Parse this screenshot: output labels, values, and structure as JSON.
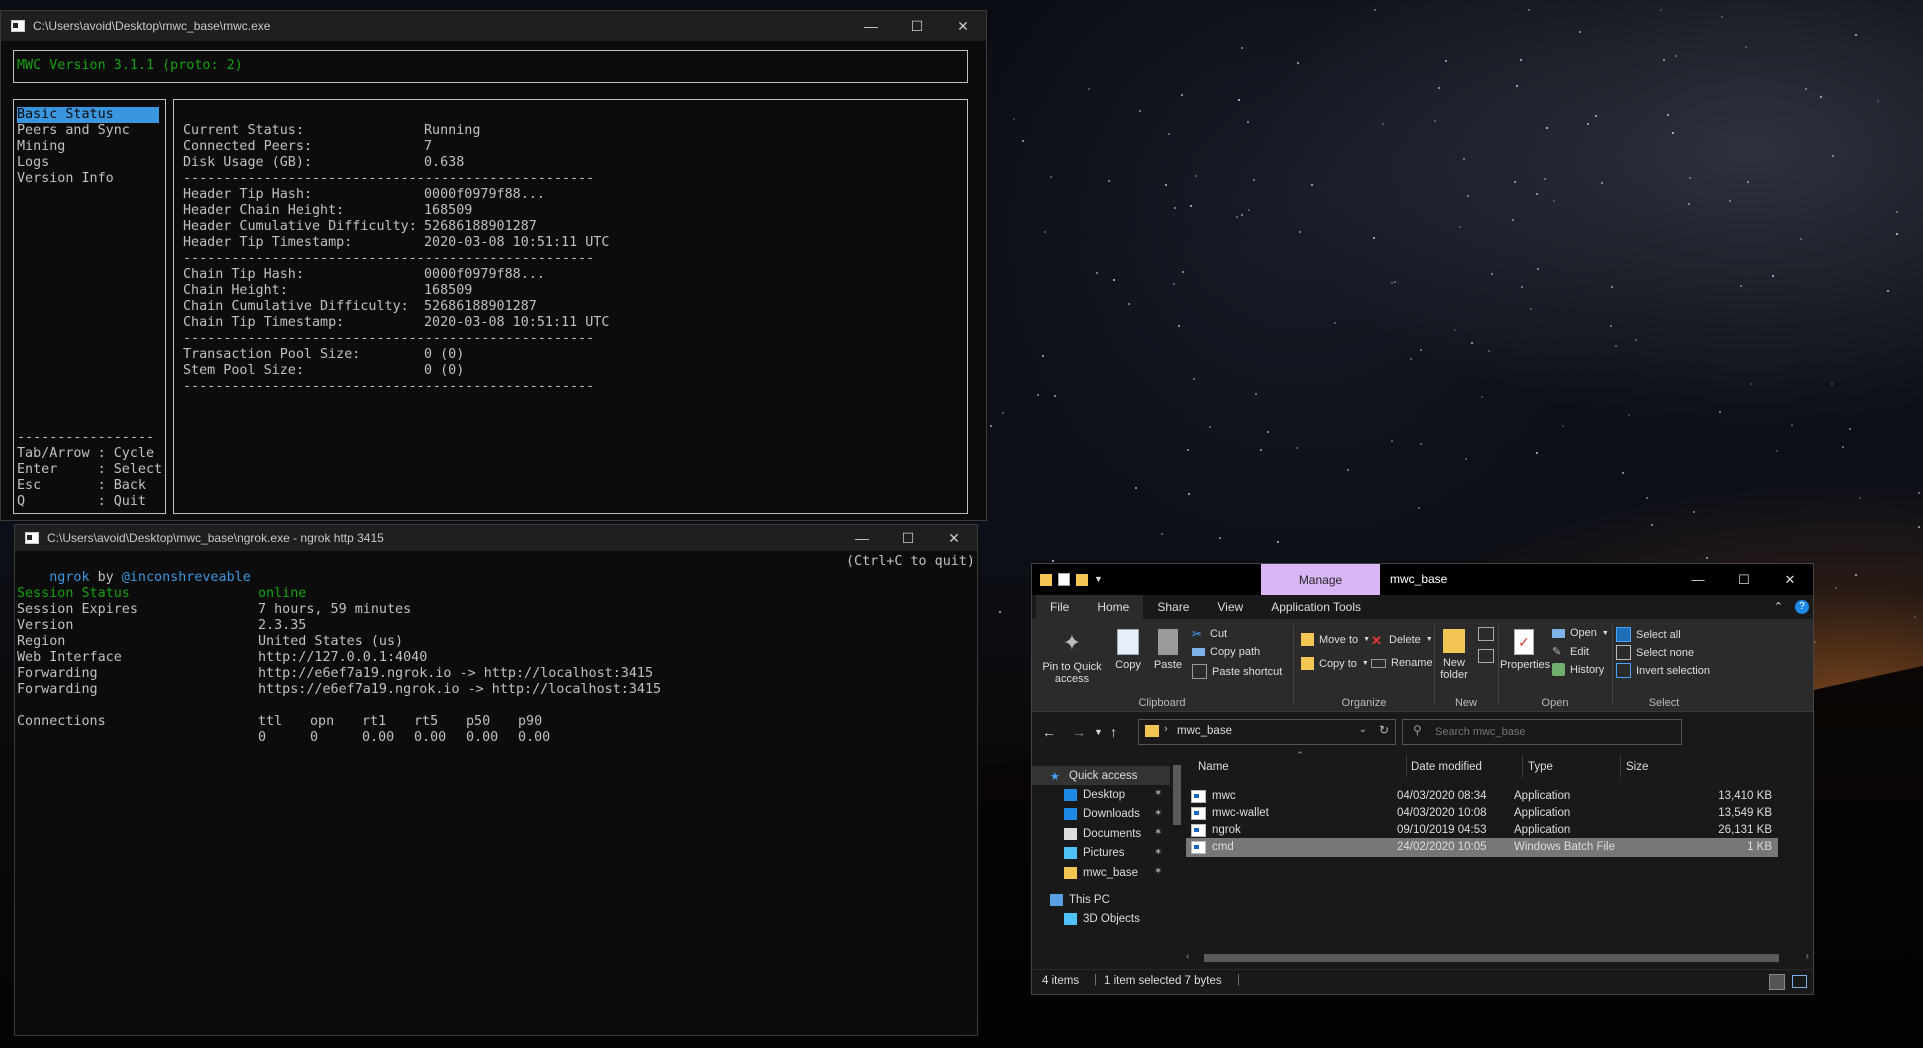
{
  "mwc": {
    "title": "C:\\Users\\avoid\\Desktop\\mwc_base\\mwc.exe",
    "version": "MWC Version 3.1.1 (proto: 2)",
    "menu": [
      "Basic Status",
      "Peers and Sync",
      "Mining",
      "Logs",
      "Version Info"
    ],
    "help_divider": "-----------------",
    "help": [
      "Tab/Arrow : Cycle",
      "Enter     : Select",
      "Esc       : Back",
      "Q         : Quit"
    ],
    "divider": "---------------------------------------------------",
    "status_groups": [
      [
        [
          "Current Status:",
          "Running"
        ],
        [
          "Connected Peers:",
          "7"
        ],
        [
          "Disk Usage (GB):",
          "0.638"
        ]
      ],
      [
        [
          "Header Tip Hash:",
          "0000f0979f88..."
        ],
        [
          "Header Chain Height:",
          "168509"
        ],
        [
          "Header Cumulative Difficulty:",
          "52686188901287"
        ],
        [
          "Header Tip Timestamp:",
          "2020-03-08 10:51:11 UTC"
        ]
      ],
      [
        [
          "Chain Tip Hash:",
          "0000f0979f88..."
        ],
        [
          "Chain Height:",
          "168509"
        ],
        [
          "Chain Cumulative Difficulty:",
          "52686188901287"
        ],
        [
          "Chain Tip Timestamp:",
          "2020-03-08 10:51:11 UTC"
        ]
      ],
      [
        [
          "Transaction Pool Size:",
          "0 (0)"
        ],
        [
          "Stem Pool Size:",
          "0 (0)"
        ]
      ]
    ]
  },
  "ngrok": {
    "title": "C:\\Users\\avoid\\Desktop\\mwc_base\\ngrok.exe - ngrok  http 3415",
    "brand": "ngrok",
    "by": " by ",
    "author": "@inconshreveable",
    "quit_hint": "(Ctrl+C to quit)",
    "fields": [
      {
        "k": "Session Status",
        "v": "online",
        "color": "#13a10e"
      },
      {
        "k": "Session Expires",
        "v": "7 hours, 59 minutes",
        "color": ""
      },
      {
        "k": "Version",
        "v": "2.3.35",
        "color": ""
      },
      {
        "k": "Region",
        "v": "United States (us)",
        "color": ""
      },
      {
        "k": "Web Interface",
        "v": "http://127.0.0.1:4040",
        "color": ""
      },
      {
        "k": "Forwarding",
        "v": "http://e6ef7a19.ngrok.io -> http://localhost:3415",
        "color": ""
      },
      {
        "k": "Forwarding",
        "v": "https://e6ef7a19.ngrok.io -> http://localhost:3415",
        "color": ""
      }
    ],
    "connections_label": "Connections",
    "conn_headers": [
      "ttl",
      "opn",
      "rt1",
      "rt5",
      "p50",
      "p90"
    ],
    "conn_values": [
      "0",
      "0",
      "0.00",
      "0.00",
      "0.00",
      "0.00"
    ]
  },
  "explorer": {
    "manage": "Manage",
    "title": "mwc_base",
    "tabs": [
      "File",
      "Home",
      "Share",
      "View",
      "Application Tools"
    ],
    "clipboard": {
      "pin": "Pin to Quick access",
      "copy": "Copy",
      "paste": "Paste",
      "cut": "Cut",
      "copy_path": "Copy path",
      "paste_shortcut": "Paste shortcut",
      "label": "Clipboard"
    },
    "organize": {
      "move_to": "Move to",
      "copy_to": "Copy to",
      "delete": "Delete",
      "rename": "Rename",
      "label": "Organize"
    },
    "new": {
      "new_folder": "New folder",
      "label": "New"
    },
    "open": {
      "properties": "Properties",
      "open": "Open",
      "edit": "Edit",
      "history": "History",
      "label": "Open"
    },
    "select": {
      "select_all": "Select all",
      "select_none": "Select none",
      "invert": "Invert selection",
      "label": "Select"
    },
    "address": "mwc_base",
    "search_placeholder": "Search mwc_base",
    "nav": {
      "quick_access": "Quick access",
      "items": [
        "Desktop",
        "Downloads",
        "Documents",
        "Pictures",
        "mwc_base"
      ],
      "this_pc": "This PC",
      "objects": "3D Objects"
    },
    "columns": [
      "Name",
      "Date modified",
      "Type",
      "Size"
    ],
    "files": [
      {
        "name": "mwc",
        "date": "04/03/2020 08:34",
        "type": "Application",
        "size": "13,410 KB"
      },
      {
        "name": "mwc-wallet",
        "date": "04/03/2020 10:08",
        "type": "Application",
        "size": "13,549 KB"
      },
      {
        "name": "ngrok",
        "date": "09/10/2019 04:53",
        "type": "Application",
        "size": "26,131 KB"
      },
      {
        "name": "cmd",
        "date": "24/02/2020 10:05",
        "type": "Windows Batch File",
        "size": "1 KB"
      }
    ],
    "status": {
      "items": "4 items",
      "selected": "1 item selected  7 bytes"
    }
  }
}
